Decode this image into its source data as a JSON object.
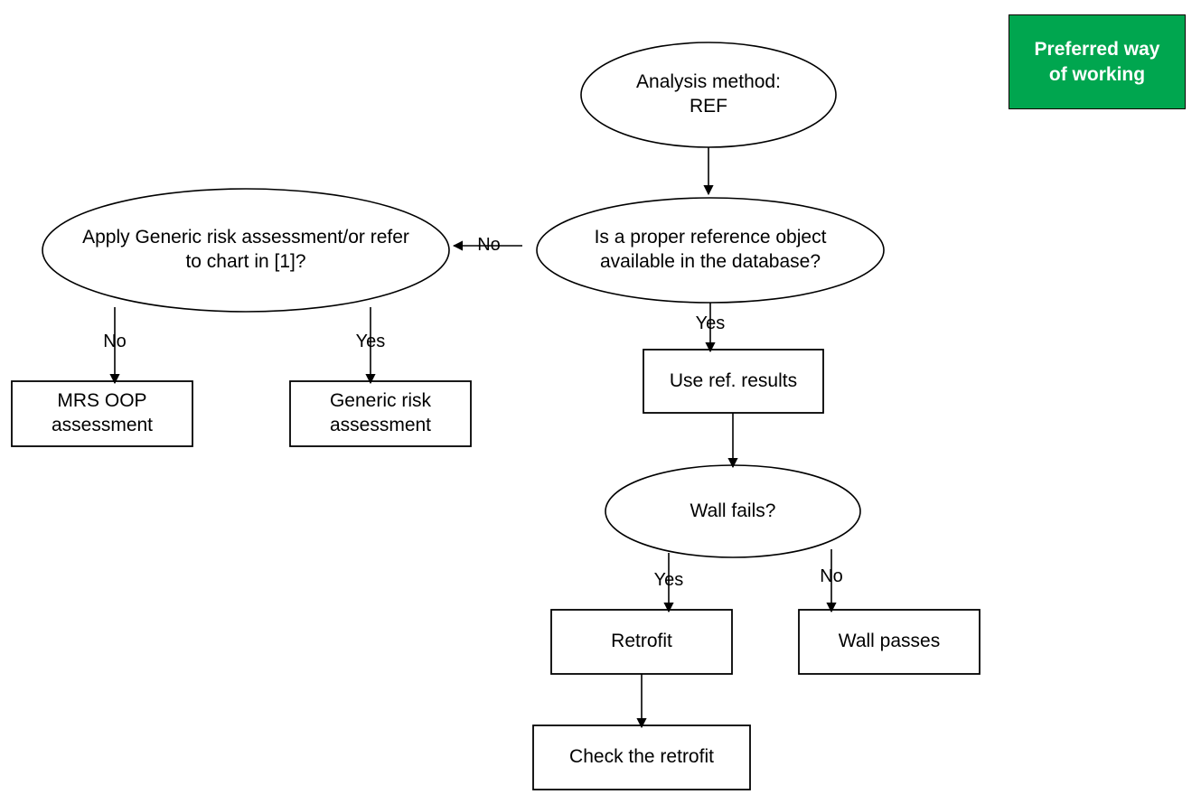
{
  "diagram": {
    "title": "Analysis method REF decision flowchart",
    "background_color": "#ffffff",
    "line_color": "#000000",
    "text_color": "#000000"
  },
  "legend": {
    "label": "Preferred way\nof working",
    "background_color": "#00A64F",
    "text_color": "#ffffff",
    "border_color": "#000000"
  },
  "nodes": {
    "analysis_method": {
      "label": "Analysis method:\nREF",
      "shape": "ellipse"
    },
    "reference_object": {
      "label": "Is a proper reference object\navailable in the database?",
      "shape": "ellipse"
    },
    "apply_generic": {
      "label": "Apply Generic risk assessment/or refer\nto chart in [1]?",
      "shape": "ellipse"
    },
    "mrs_oop": {
      "label": "MRS OOP\nassessment",
      "shape": "rectangle"
    },
    "generic_risk": {
      "label": "Generic risk\nassessment",
      "shape": "rectangle"
    },
    "use_ref_results": {
      "label": "Use ref. results",
      "shape": "rectangle"
    },
    "wall_fails": {
      "label": "Wall fails?",
      "shape": "ellipse"
    },
    "retrofit": {
      "label": "Retrofit",
      "shape": "rectangle"
    },
    "wall_passes": {
      "label": "Wall passes",
      "shape": "rectangle"
    },
    "check_retrofit": {
      "label": "Check the retrofit",
      "shape": "rectangle"
    }
  },
  "edge_labels": {
    "ref_to_apply_no": "No",
    "ref_to_use_yes": "Yes",
    "apply_to_mrs_no": "No",
    "apply_to_generic_yes": "Yes",
    "wall_to_retrofit_yes": "Yes",
    "wall_to_passes_no": "No"
  }
}
